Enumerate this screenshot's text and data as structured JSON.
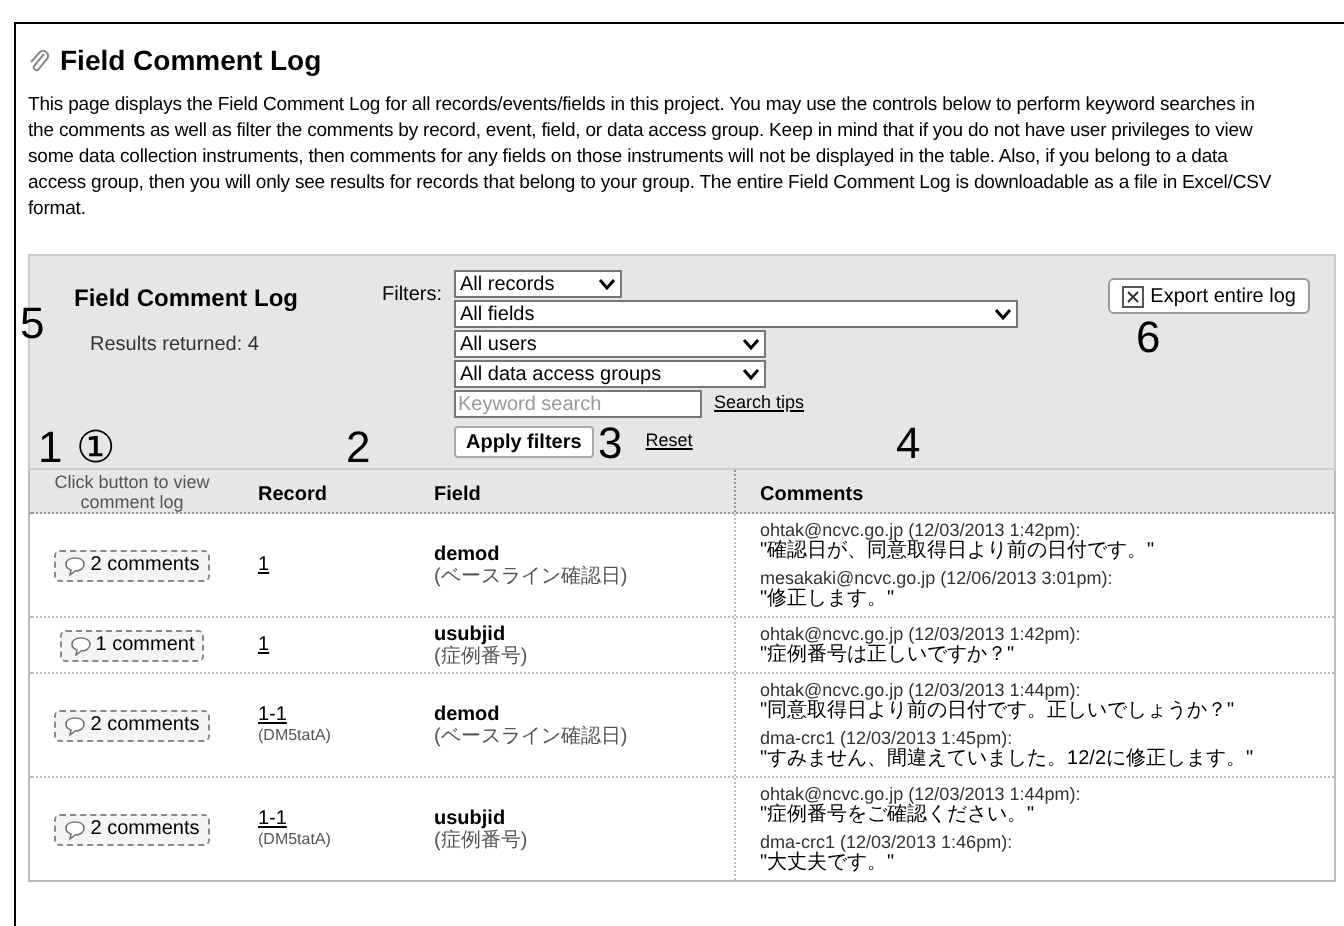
{
  "page": {
    "title": "Field Comment Log",
    "description": "This page displays the Field Comment Log for all records/events/fields in this project. You may use the controls below to perform keyword searches in the comments as well as filter the comments by record, event, field, or data access group. Keep in mind that if you do not have user privileges to view some data collection instruments, then comments for any fields on those instruments will not be displayed in the table. Also, if you belong to a data access group, then you will only see results for records that belong to your group. The entire Field Comment Log is downloadable as a file in Excel/CSV format."
  },
  "panel": {
    "title": "Field Comment Log",
    "results": "Results returned: 4",
    "filters_label": "Filters:",
    "filters": [
      {
        "value": "All records",
        "kind": "short"
      },
      {
        "value": "All fields",
        "kind": "wide"
      },
      {
        "value": "All users",
        "kind": "medium"
      },
      {
        "value": "All data access groups",
        "kind": "medium"
      }
    ],
    "search": {
      "placeholder": "Keyword search"
    },
    "search_tips": "Search tips",
    "apply": "Apply filters",
    "reset": "Reset",
    "export": "Export entire log"
  },
  "table": {
    "columns": [
      "Click button to view comment log",
      "Record",
      "Field",
      "Comments"
    ],
    "rows": [
      {
        "button": "2 comments",
        "record": "1",
        "record_group": "",
        "field": "demod",
        "field_label": "(ベースライン確認日)",
        "comments": [
          {
            "author": "ohtak@ncvc.go.jp (12/03/2013 1:42pm):",
            "text": "\"確認日が、同意取得日より前の日付です。\""
          },
          {
            "author": "mesakaki@ncvc.go.jp (12/06/2013 3:01pm):",
            "text": "\"修正します。\""
          }
        ]
      },
      {
        "button": "1 comment",
        "record": "1",
        "record_group": "",
        "field": "usubjid",
        "field_label": "(症例番号)",
        "comments": [
          {
            "author": "ohtak@ncvc.go.jp (12/03/2013 1:42pm):",
            "text": "\"症例番号は正しいですか？\""
          }
        ]
      },
      {
        "button": "2 comments",
        "record": "1-1",
        "record_group": "(DM5tatA)",
        "field": "demod",
        "field_label": "(ベースライン確認日)",
        "comments": [
          {
            "author": "ohtak@ncvc.go.jp (12/03/2013 1:44pm):",
            "text": "\"同意取得日より前の日付です。正しいでしょうか？\""
          },
          {
            "author": "dma-crc1 (12/03/2013 1:45pm):",
            "text": "\"すみません、間違えていました。12/2に修正します。\""
          }
        ]
      },
      {
        "button": "2 comments",
        "record": "1-1",
        "record_group": "(DM5tatA)",
        "field": "usubjid",
        "field_label": "(症例番号)",
        "comments": [
          {
            "author": "ohtak@ncvc.go.jp (12/03/2013 1:44pm):",
            "text": "\"症例番号をご確認ください。\""
          },
          {
            "author": "dma-crc1 (12/03/2013 1:46pm):",
            "text": "\"大丈夫です。\""
          }
        ]
      }
    ]
  },
  "annotations": [
    "5",
    "6",
    "1",
    "①",
    "2",
    "3",
    "4"
  ]
}
